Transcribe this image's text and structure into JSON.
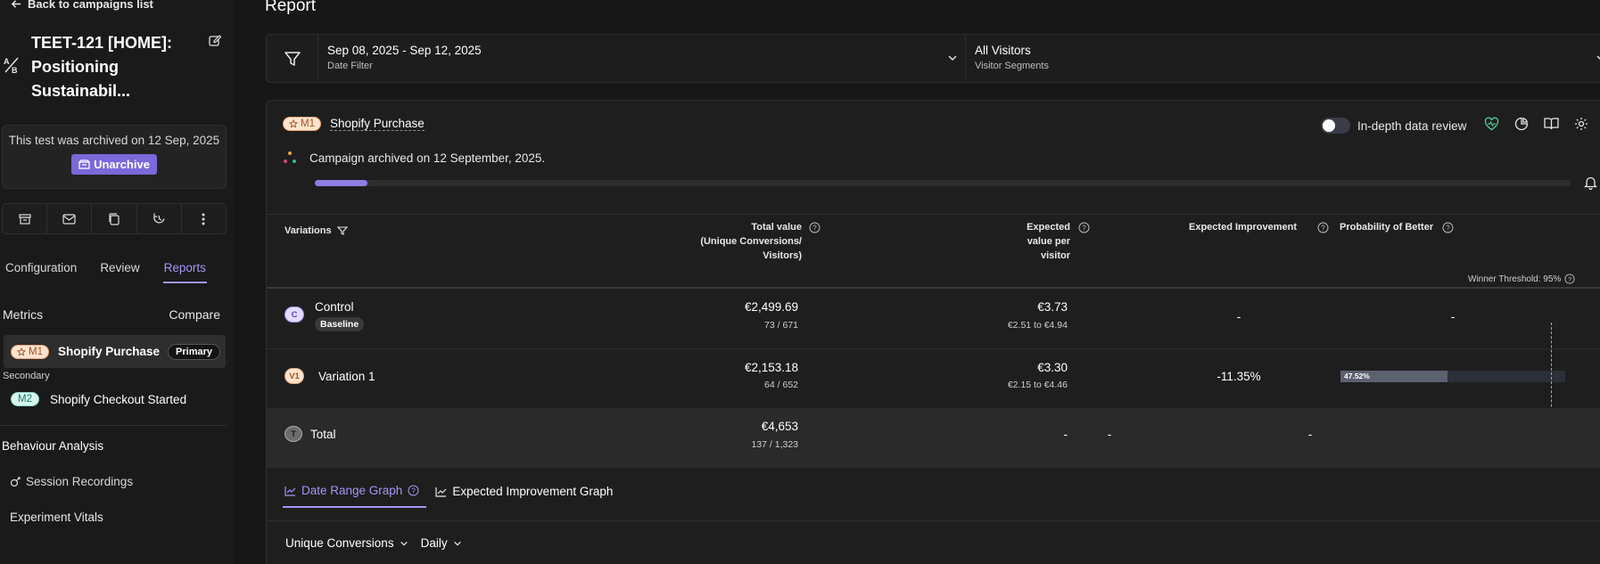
{
  "sidebar": {
    "back_label": "Back to campaigns list",
    "campaign_title": "TEET-121 [HOME]: Positioning Sustainabil...",
    "archived_text": "This test was archived on 12 Sep, 2025",
    "unarchive_label": "Unarchive",
    "tabs": [
      {
        "label": "Configuration"
      },
      {
        "label": "Review"
      },
      {
        "label": "Reports"
      }
    ],
    "metrics_label": "Metrics",
    "compare_label": "Compare",
    "primary_metric": {
      "badge": "M1",
      "name": "Shopify Purchase",
      "pill": "Primary"
    },
    "secondary_label": "Secondary",
    "secondary_metric": {
      "badge": "M2",
      "name": "Shopify Checkout Started"
    },
    "behaviour_label": "Behaviour Analysis",
    "session_label": "Session Recordings",
    "vitals_label": "Experiment Vitals"
  },
  "main": {
    "title": "Report",
    "date_filter": {
      "value": "Sep 08, 2025 - Sep 12, 2025",
      "label": "Date Filter"
    },
    "segment_filter": {
      "value": "All Visitors",
      "label": "Visitor Segments"
    },
    "card": {
      "metric_badge": "M1",
      "metric_name": "Shopify Purchase",
      "toggle_label": "In-depth data review",
      "archived_msg": "Campaign archived on 12 September, 2025.",
      "progress": 0.04,
      "columns": {
        "variations": "Variations",
        "total_value_1": "Total value",
        "total_value_2": "(Unique Conversions/",
        "total_value_3": "Visitors)",
        "expected_1": "Expected",
        "expected_2": "value per",
        "expected_3": "visitor",
        "improvement": "Expected Improvement",
        "probability": "Probability of Better",
        "winner_threshold": "Winner Threshold: 95%"
      },
      "rows": [
        {
          "badge": "C",
          "name": "Control",
          "tag": "Baseline",
          "total": "€2,499.69",
          "conv": "73 / 671",
          "expected": "€3.73",
          "range": "€2.51 to €4.94",
          "improvement": "-",
          "probability": "-"
        },
        {
          "badge": "V1",
          "name": "Variation 1",
          "total": "€2,153.18",
          "conv": "64 / 652",
          "expected": "€3.30",
          "range": "€2.15 to €4.46",
          "improvement": "-11.35%",
          "probability": "47.52%",
          "probability_value": 0.4752
        },
        {
          "badge": "T",
          "name": "Total",
          "total": "€4,653",
          "conv": "137 / 1,323",
          "expected": "-",
          "improvement": "-",
          "probability": "-"
        }
      ],
      "graph_tabs": [
        {
          "label": "Date Range Graph"
        },
        {
          "label": "Expected Improvement Graph"
        }
      ],
      "dropdowns": {
        "metric": "Unique Conversions",
        "interval": "Daily"
      }
    }
  },
  "colors": {
    "accent": "#a694f7",
    "button": "#7b68d9",
    "threshold": "#58d1a8"
  }
}
